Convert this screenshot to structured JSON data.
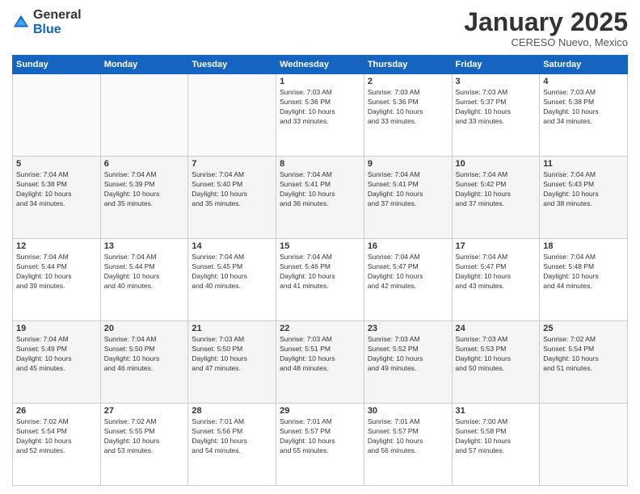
{
  "logo": {
    "general": "General",
    "blue": "Blue"
  },
  "title": "January 2025",
  "location": "CERESO Nuevo, Mexico",
  "days_header": [
    "Sunday",
    "Monday",
    "Tuesday",
    "Wednesday",
    "Thursday",
    "Friday",
    "Saturday"
  ],
  "weeks": [
    {
      "shaded": false,
      "days": [
        {
          "num": "",
          "info": ""
        },
        {
          "num": "",
          "info": ""
        },
        {
          "num": "",
          "info": ""
        },
        {
          "num": "1",
          "info": "Sunrise: 7:03 AM\nSunset: 5:36 PM\nDaylight: 10 hours\nand 33 minutes."
        },
        {
          "num": "2",
          "info": "Sunrise: 7:03 AM\nSunset: 5:36 PM\nDaylight: 10 hours\nand 33 minutes."
        },
        {
          "num": "3",
          "info": "Sunrise: 7:03 AM\nSunset: 5:37 PM\nDaylight: 10 hours\nand 33 minutes."
        },
        {
          "num": "4",
          "info": "Sunrise: 7:03 AM\nSunset: 5:38 PM\nDaylight: 10 hours\nand 34 minutes."
        }
      ]
    },
    {
      "shaded": true,
      "days": [
        {
          "num": "5",
          "info": "Sunrise: 7:04 AM\nSunset: 5:38 PM\nDaylight: 10 hours\nand 34 minutes."
        },
        {
          "num": "6",
          "info": "Sunrise: 7:04 AM\nSunset: 5:39 PM\nDaylight: 10 hours\nand 35 minutes."
        },
        {
          "num": "7",
          "info": "Sunrise: 7:04 AM\nSunset: 5:40 PM\nDaylight: 10 hours\nand 35 minutes."
        },
        {
          "num": "8",
          "info": "Sunrise: 7:04 AM\nSunset: 5:41 PM\nDaylight: 10 hours\nand 36 minutes."
        },
        {
          "num": "9",
          "info": "Sunrise: 7:04 AM\nSunset: 5:41 PM\nDaylight: 10 hours\nand 37 minutes."
        },
        {
          "num": "10",
          "info": "Sunrise: 7:04 AM\nSunset: 5:42 PM\nDaylight: 10 hours\nand 37 minutes."
        },
        {
          "num": "11",
          "info": "Sunrise: 7:04 AM\nSunset: 5:43 PM\nDaylight: 10 hours\nand 38 minutes."
        }
      ]
    },
    {
      "shaded": false,
      "days": [
        {
          "num": "12",
          "info": "Sunrise: 7:04 AM\nSunset: 5:44 PM\nDaylight: 10 hours\nand 39 minutes."
        },
        {
          "num": "13",
          "info": "Sunrise: 7:04 AM\nSunset: 5:44 PM\nDaylight: 10 hours\nand 40 minutes."
        },
        {
          "num": "14",
          "info": "Sunrise: 7:04 AM\nSunset: 5:45 PM\nDaylight: 10 hours\nand 40 minutes."
        },
        {
          "num": "15",
          "info": "Sunrise: 7:04 AM\nSunset: 5:46 PM\nDaylight: 10 hours\nand 41 minutes."
        },
        {
          "num": "16",
          "info": "Sunrise: 7:04 AM\nSunset: 5:47 PM\nDaylight: 10 hours\nand 42 minutes."
        },
        {
          "num": "17",
          "info": "Sunrise: 7:04 AM\nSunset: 5:47 PM\nDaylight: 10 hours\nand 43 minutes."
        },
        {
          "num": "18",
          "info": "Sunrise: 7:04 AM\nSunset: 5:48 PM\nDaylight: 10 hours\nand 44 minutes."
        }
      ]
    },
    {
      "shaded": true,
      "days": [
        {
          "num": "19",
          "info": "Sunrise: 7:04 AM\nSunset: 5:49 PM\nDaylight: 10 hours\nand 45 minutes."
        },
        {
          "num": "20",
          "info": "Sunrise: 7:04 AM\nSunset: 5:50 PM\nDaylight: 10 hours\nand 46 minutes."
        },
        {
          "num": "21",
          "info": "Sunrise: 7:03 AM\nSunset: 5:50 PM\nDaylight: 10 hours\nand 47 minutes."
        },
        {
          "num": "22",
          "info": "Sunrise: 7:03 AM\nSunset: 5:51 PM\nDaylight: 10 hours\nand 48 minutes."
        },
        {
          "num": "23",
          "info": "Sunrise: 7:03 AM\nSunset: 5:52 PM\nDaylight: 10 hours\nand 49 minutes."
        },
        {
          "num": "24",
          "info": "Sunrise: 7:03 AM\nSunset: 5:53 PM\nDaylight: 10 hours\nand 50 minutes."
        },
        {
          "num": "25",
          "info": "Sunrise: 7:02 AM\nSunset: 5:54 PM\nDaylight: 10 hours\nand 51 minutes."
        }
      ]
    },
    {
      "shaded": false,
      "days": [
        {
          "num": "26",
          "info": "Sunrise: 7:02 AM\nSunset: 5:54 PM\nDaylight: 10 hours\nand 52 minutes."
        },
        {
          "num": "27",
          "info": "Sunrise: 7:02 AM\nSunset: 5:55 PM\nDaylight: 10 hours\nand 53 minutes."
        },
        {
          "num": "28",
          "info": "Sunrise: 7:01 AM\nSunset: 5:56 PM\nDaylight: 10 hours\nand 54 minutes."
        },
        {
          "num": "29",
          "info": "Sunrise: 7:01 AM\nSunset: 5:57 PM\nDaylight: 10 hours\nand 55 minutes."
        },
        {
          "num": "30",
          "info": "Sunrise: 7:01 AM\nSunset: 5:57 PM\nDaylight: 10 hours\nand 56 minutes."
        },
        {
          "num": "31",
          "info": "Sunrise: 7:00 AM\nSunset: 5:58 PM\nDaylight: 10 hours\nand 57 minutes."
        },
        {
          "num": "",
          "info": ""
        }
      ]
    }
  ]
}
